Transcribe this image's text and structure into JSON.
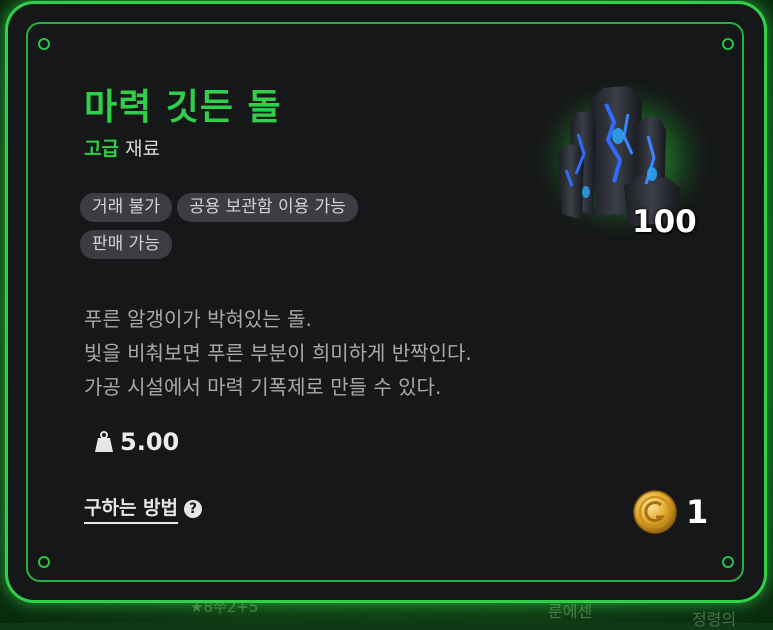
{
  "background": {
    "texts": [
      "룬에센",
      "정령의",
      "★8쭈2+5"
    ]
  },
  "item": {
    "name": "마력 깃든 돌",
    "grade": "고급",
    "category": "재료",
    "tags": [
      "거래 불가",
      "공용 보관함 이용 가능",
      "판매 가능"
    ],
    "icon": "dark-crystal-stone-icon",
    "count": "100",
    "description": [
      "푸른 알갱이가 박혀있는 돌.",
      "빛을 비춰보면 푸른 부분이 희미하게 반짝인다.",
      "가공 시설에서 마력 기폭제로 만들 수 있다."
    ],
    "weight": "5.00",
    "how_to_obtain": "구하는 방법",
    "help_symbol": "?",
    "price": "1",
    "currency_icon": "gold-coin-icon"
  },
  "colors": {
    "accent_green": "#2fcf4a",
    "card_bg": "#161718",
    "tag_bg": "#3b3d42"
  }
}
